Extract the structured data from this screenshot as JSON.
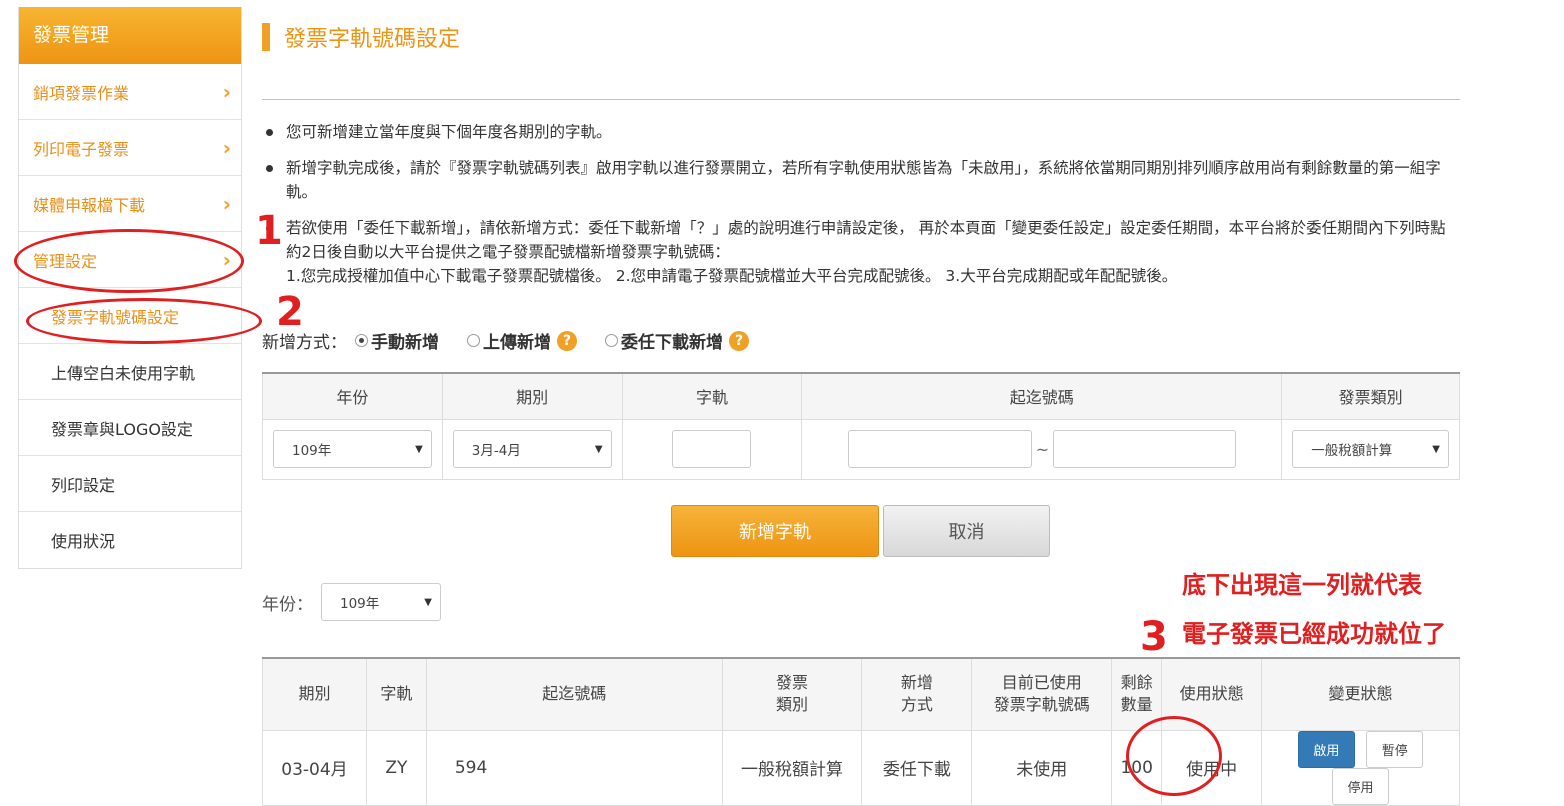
{
  "sidebar": {
    "header": "發票管理",
    "items": [
      {
        "label": "銷項發票作業"
      },
      {
        "label": "列印電子發票"
      },
      {
        "label": "媒體申報檔下載"
      },
      {
        "label": "管理設定"
      }
    ],
    "sub_items": [
      {
        "label": "發票字軌號碼設定"
      },
      {
        "label": "上傳空白未使用字軌"
      },
      {
        "label": "發票章與LOGO設定"
      },
      {
        "label": "列印設定"
      },
      {
        "label": "使用狀況"
      }
    ]
  },
  "page": {
    "title": "發票字軌號碼設定",
    "notes": [
      "您可新增建立當年度與下個年度各期別的字軌。",
      "新增字軌完成後，請於『發票字軌號碼列表』啟用字軌以進行發票開立，若所有字軌使用狀態皆為「未啟用」，系統將依當期同期別排列順序啟用尚有剩餘數量的第一組字軌。",
      "若欲使用「委任下載新增」，請依新增方式：委任下載新增「？」處的說明進行申請設定後， 再於本頁面「變更委任設定」設定委任期間，本平台將於委任期間內下列時點約2日後自動以大平台提供之電子發票配號檔新增發票字軌號碼：",
      "1.您完成授權加值中心下載電子發票配號檔後。 2.您申請電子發票配號檔並大平台完成配號後。 3.大平台完成期配或年配配號後。"
    ]
  },
  "method": {
    "label": "新增方式：",
    "options": [
      "手動新增",
      "上傳新增",
      "委任下載新增"
    ],
    "selected": "手動新增",
    "help": "?"
  },
  "form": {
    "headers": [
      "年份",
      "期別",
      "字軌",
      "起迄號碼",
      "發票類別"
    ],
    "year_value": "109年",
    "period_value": "3月-4月",
    "range_sep": "~",
    "type_value": "一般稅額計算"
  },
  "buttons": {
    "add": "新增字軌",
    "cancel": "取消"
  },
  "filter": {
    "label": "年份：",
    "value": "109年"
  },
  "list": {
    "headers": [
      "期別",
      "字軌",
      "起迄號碼",
      "發票\n類別",
      "新增\n方式",
      "目前已使用\n發票字軌號碼",
      "剩餘\n數量",
      "使用狀態",
      "變更狀態"
    ],
    "rows": [
      {
        "period": "03-04月",
        "track": "ZY",
        "range": "594",
        "type": "一般稅額計算",
        "method": "委任下載",
        "used": "未使用",
        "remain": "100",
        "status": "使用中"
      }
    ],
    "actions": [
      "啟用",
      "暫停",
      "停用"
    ]
  },
  "annotations": {
    "n1": "1",
    "n2": "2",
    "n3": "3",
    "text1": "底下出現這一列就代表",
    "text2": "電子發票已經成功就位了"
  },
  "colors": {
    "accent": "#f0a024",
    "annotation": "#e02020",
    "primary_button": "#337ab7"
  }
}
